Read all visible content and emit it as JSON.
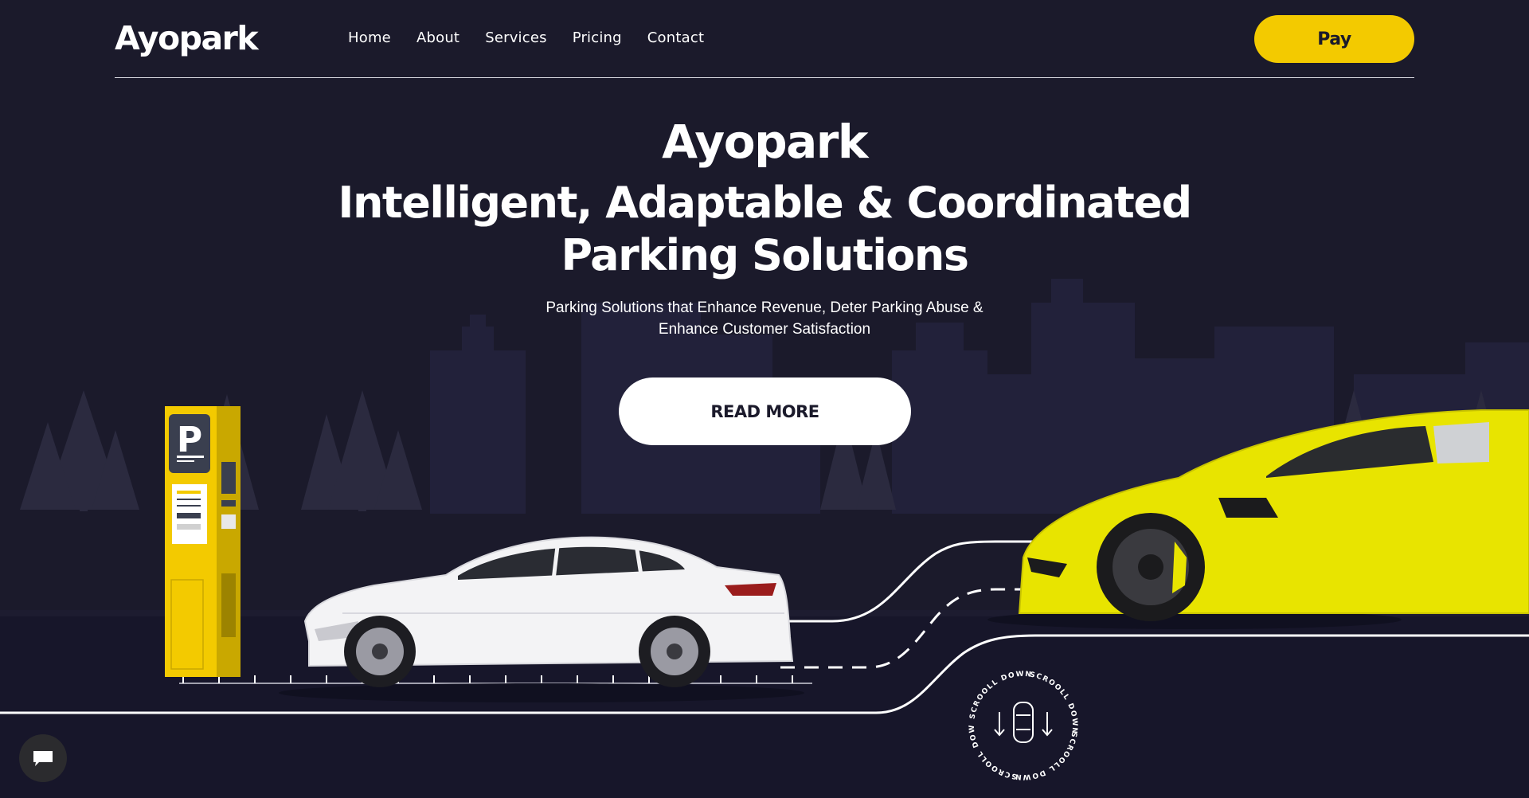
{
  "brand": {
    "logo": "Ayopark",
    "accent": "#f3ca00",
    "background": "#1b1a2b"
  },
  "nav": {
    "items": [
      {
        "label": "Home"
      },
      {
        "label": "About"
      },
      {
        "label": "Services"
      },
      {
        "label": "Pricing"
      },
      {
        "label": "Contact"
      }
    ],
    "pay_label": "Pay"
  },
  "hero": {
    "title": "Ayopark",
    "headline_line1": "Intelligent, Adaptable & Coordinated",
    "headline_line2": "Parking Solutions",
    "subtitle_line1": "Parking Solutions that Enhance Revenue, Deter Parking Abuse &",
    "subtitle_line2": "Enhance Customer Satisfaction",
    "cta_label": "READ MORE"
  },
  "scene": {
    "meter_sign": "P",
    "scroll_label": "SCROOLL DOWN"
  },
  "chat": {
    "icon": "chat-bubble-icon"
  }
}
